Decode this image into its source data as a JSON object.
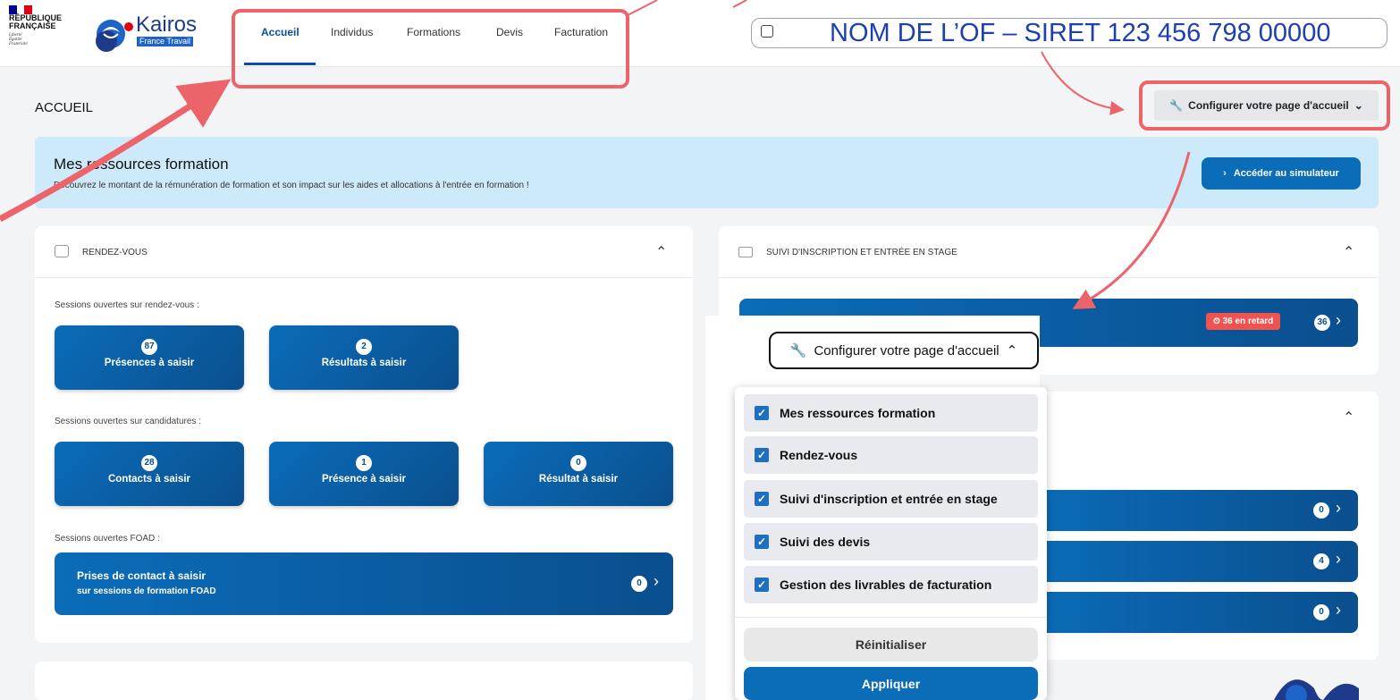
{
  "header": {
    "republique_line1": "RÉPUBLIQUE",
    "republique_line2": "FRANÇAISE",
    "motto": "Liberté Égalité Fraternité",
    "app_name": "Kairos",
    "app_sub": "France Travail",
    "tabs": [
      {
        "label": "Accueil",
        "active": true
      },
      {
        "label": "Individus"
      },
      {
        "label": "Formations"
      },
      {
        "label": "Devis"
      },
      {
        "label": "Facturation"
      }
    ],
    "siret": "NOM DE L’OF – SIRET 123 456 798 00000"
  },
  "page": {
    "title": "ACCUEIL",
    "config_button": "Configurer votre page d'accueil"
  },
  "banner": {
    "title": "Mes ressources formation",
    "subtitle": "Découvrez le montant de la rémunération de formation et son impact sur les aides et allocations à l'entrée en formation !",
    "button": "Accéder au simulateur"
  },
  "rdv": {
    "title": "RENDEZ-VOUS",
    "section1": "Sessions ouvertes sur rendez-vous :",
    "tiles1": [
      {
        "count": "87",
        "label": "Présences à saisir"
      },
      {
        "count": "2",
        "label": "Résultats à saisir"
      }
    ],
    "section2": "Sessions ouvertes sur candidatures :",
    "tiles2": [
      {
        "count": "28",
        "label": "Contacts à saisir"
      },
      {
        "count": "1",
        "label": "Présence à saisir"
      },
      {
        "count": "0",
        "label": "Résultat à saisir"
      }
    ],
    "section3": "Sessions ouvertes FOAD :",
    "foad_line1": "Prises de contact à saisir",
    "foad_line2": "sur sessions de formation FOAD",
    "foad_count": "0"
  },
  "suivi": {
    "title": "SUIVI D'INSCRIPTION ET ENTRÉE EN STAGE",
    "late": "36 en retard",
    "count": "36"
  },
  "panel3": {
    "counts": [
      "0",
      "4",
      "0"
    ]
  },
  "popover": {
    "button": "Configurer votre page d'accueil",
    "items": [
      "Mes ressources formation",
      "Rendez-vous",
      "Suivi d'inscription et entrée en stage",
      "Suivi des devis",
      "Gestion des livrables de facturation"
    ],
    "reset": "Réinitialiser",
    "apply": "Appliquer"
  },
  "colors": {
    "primary": "#0b6cb8",
    "highlight": "#ec6469",
    "banner": "#cdeafb"
  }
}
